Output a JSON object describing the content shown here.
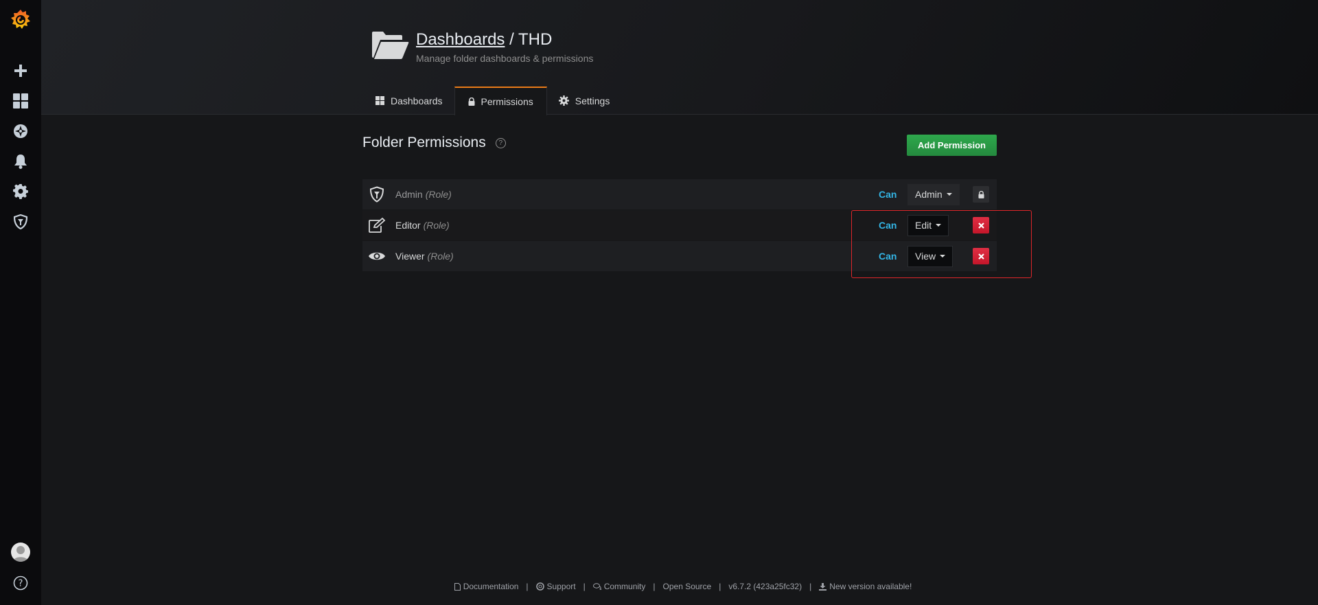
{
  "header": {
    "breadcrumb_link": "Dashboards",
    "breadcrumb_sep": " / ",
    "folder_name": "THD",
    "subtitle": "Manage folder dashboards & permissions"
  },
  "tabs": [
    {
      "label": "Dashboards",
      "icon": "grid-icon",
      "active": false
    },
    {
      "label": "Permissions",
      "icon": "lock-icon",
      "active": true
    },
    {
      "label": "Settings",
      "icon": "gear-icon",
      "active": false
    }
  ],
  "section": {
    "title": "Folder Permissions",
    "add_button": "Add Permission"
  },
  "permissions": [
    {
      "name": "Admin",
      "tag": "(Role)",
      "can": "Can",
      "level": "Admin",
      "icon": "shield-icon",
      "action": "lock-icon"
    },
    {
      "name": "Editor",
      "tag": "(Role)",
      "can": "Can",
      "level": "Edit",
      "icon": "edit-icon",
      "action": "remove-icon"
    },
    {
      "name": "Viewer",
      "tag": "(Role)",
      "can": "Can",
      "level": "View",
      "icon": "eye-icon",
      "action": "remove-icon"
    }
  ],
  "footer": {
    "documentation": "Documentation",
    "support": "Support",
    "community": "Community",
    "open_source": "Open Source",
    "version": "v6.7.2 (423a25fc32)",
    "new_version": "New version available!",
    "separator": "|"
  },
  "colors": {
    "accent_orange": "#eb7b18",
    "link_blue": "#33b5e5",
    "success_green": "#299c46",
    "danger_red": "#e02f44",
    "highlight_red": "#e0262a"
  }
}
